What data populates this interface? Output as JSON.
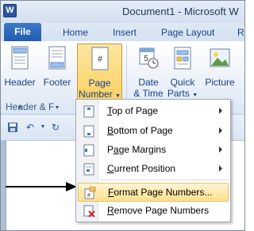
{
  "window": {
    "app_icon_letter": "W",
    "title": "Document1 - Microsoft W"
  },
  "tabs": {
    "file": "File",
    "home": "Home",
    "insert": "Insert",
    "page_layout": "Page Layout",
    "extra": "R"
  },
  "ribbon": {
    "header": {
      "line1": "Header",
      "icon": "header-icon"
    },
    "footer": {
      "line1": "Footer",
      "icon": "footer-icon"
    },
    "page_number": {
      "line1": "Page",
      "line2": "Number",
      "icon": "page-number-icon"
    },
    "date_time": {
      "line1": "Date",
      "line2": "& Time",
      "icon": "calendar-clock-icon"
    },
    "quick_parts": {
      "line1": "Quick",
      "line2": "Parts",
      "icon": "quick-parts-icon"
    },
    "picture": {
      "line1": "Picture",
      "icon": "picture-icon"
    },
    "group_label": "Header & F"
  },
  "page_number_menu": {
    "items": [
      {
        "label_ul": "T",
        "label_rest": "op of Page",
        "icon": "top-of-page-icon",
        "has_submenu": true
      },
      {
        "label_ul": "B",
        "label_rest": "ottom of Page",
        "icon": "bottom-of-page-icon",
        "has_submenu": true
      },
      {
        "label_pre": "P",
        "label_ul": "a",
        "label_rest": "ge Margins",
        "icon": "page-margins-icon",
        "has_submenu": true
      },
      {
        "label_ul": "C",
        "label_rest": "urrent Position",
        "icon": "current-position-icon",
        "has_submenu": true
      },
      {
        "label_ul": "F",
        "label_rest": "ormat Page Numbers...",
        "icon": "format-page-numbers-icon",
        "has_submenu": false,
        "highlighted": true
      },
      {
        "label_ul": "R",
        "label_rest": "emove Page Numbers",
        "icon": "remove-page-numbers-icon",
        "has_submenu": false
      }
    ]
  },
  "annotation": {
    "pointer": "arrow-pointing-right"
  },
  "colors": {
    "file_tab": "#1f5bb0",
    "pressed_button": "#fbd160",
    "menu_highlight": "#ffe08a"
  }
}
